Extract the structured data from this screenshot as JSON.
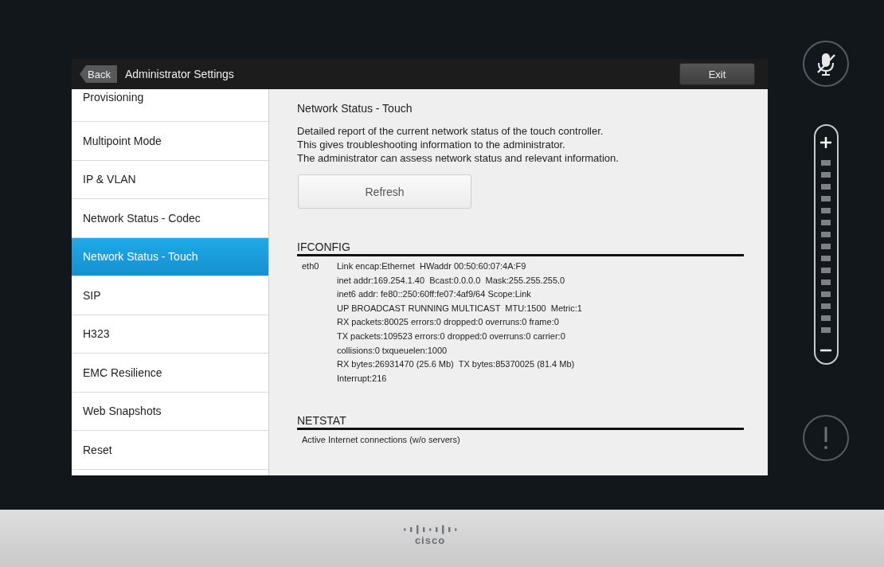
{
  "header": {
    "back": "Back",
    "title": "Administrator Settings",
    "exit": "Exit"
  },
  "sidebar": {
    "items": [
      {
        "label": "Provisioning",
        "selected": false
      },
      {
        "label": "Multipoint Mode",
        "selected": false
      },
      {
        "label": "IP & VLAN",
        "selected": false
      },
      {
        "label": "Network Status - Codec",
        "selected": false
      },
      {
        "label": "Network Status - Touch",
        "selected": true
      },
      {
        "label": "SIP",
        "selected": false
      },
      {
        "label": "H323",
        "selected": false
      },
      {
        "label": "EMC Resilience",
        "selected": false
      },
      {
        "label": "Web Snapshots",
        "selected": false
      },
      {
        "label": "Reset",
        "selected": false
      }
    ]
  },
  "content": {
    "title": "Network Status - Touch",
    "description": [
      "Detailed report of the current network status of the touch controller.",
      "This gives troubleshooting information to the administrator.",
      "The administrator can assess network status and relevant information."
    ],
    "refresh": "Refresh",
    "sections": [
      {
        "heading": "IFCONFIG",
        "interface": "eth0",
        "lines": [
          "Link encap:Ethernet  HWaddr 00:50:60:07:4A:F9",
          "inet addr:169.254.1.40  Bcast:0.0.0.0  Mask:255.255.255.0",
          "inet6 addr: fe80::250:60ff:fe07:4af9/64 Scope:Link",
          "UP BROADCAST RUNNING MULTICAST  MTU:1500  Metric:1",
          "RX packets:80025 errors:0 dropped:0 overruns:0 frame:0",
          "TX packets:109523 errors:0 dropped:0 overruns:0 carrier:0",
          "collisions:0 txqueuelen:1000",
          "RX bytes:26931470 (25.6 Mb)  TX bytes:85370025 (81.4 Mb)",
          "Interrupt:216"
        ]
      },
      {
        "heading": "NETSTAT",
        "lines": [
          "Active Internet connections (w/o servers)"
        ]
      }
    ]
  },
  "footer": {
    "logo": "cisco"
  }
}
